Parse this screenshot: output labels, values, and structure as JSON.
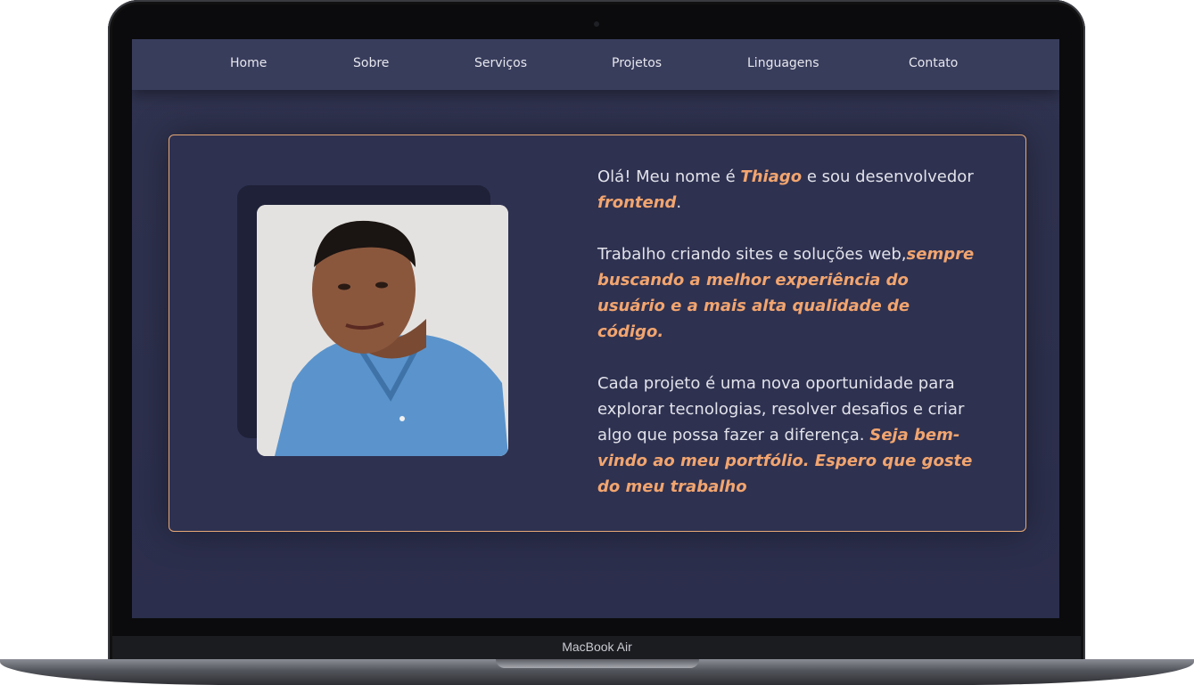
{
  "device": {
    "brand_label": "MacBook Air"
  },
  "nav": {
    "items": [
      {
        "label": "Home"
      },
      {
        "label": "Sobre"
      },
      {
        "label": "Serviços"
      },
      {
        "label": "Projetos"
      },
      {
        "label": "Linguagens"
      },
      {
        "label": "Contato"
      }
    ]
  },
  "about": {
    "photo_alt": "Thiago",
    "p1": {
      "a": "Olá! Meu nome é ",
      "name": "Thiago",
      "b": " e sou desenvolvedor ",
      "role": "frontend",
      "c": "."
    },
    "p2": {
      "a": "Trabalho criando sites e soluções web,",
      "highlight": "sempre buscando a melhor experiência do usuário e a mais alta qualidade de código."
    },
    "p3": {
      "a": "Cada projeto é uma nova oportunidade para explorar tecnologias, resolver desafios e criar algo que possa fazer a diferença. ",
      "highlight": "Seja bem-vindo ao meu portfólio. Espero que goste do meu trabalho"
    }
  },
  "colors": {
    "accent": "#f2a56f",
    "background": "#2e3150",
    "navbar": "#393d5c"
  }
}
